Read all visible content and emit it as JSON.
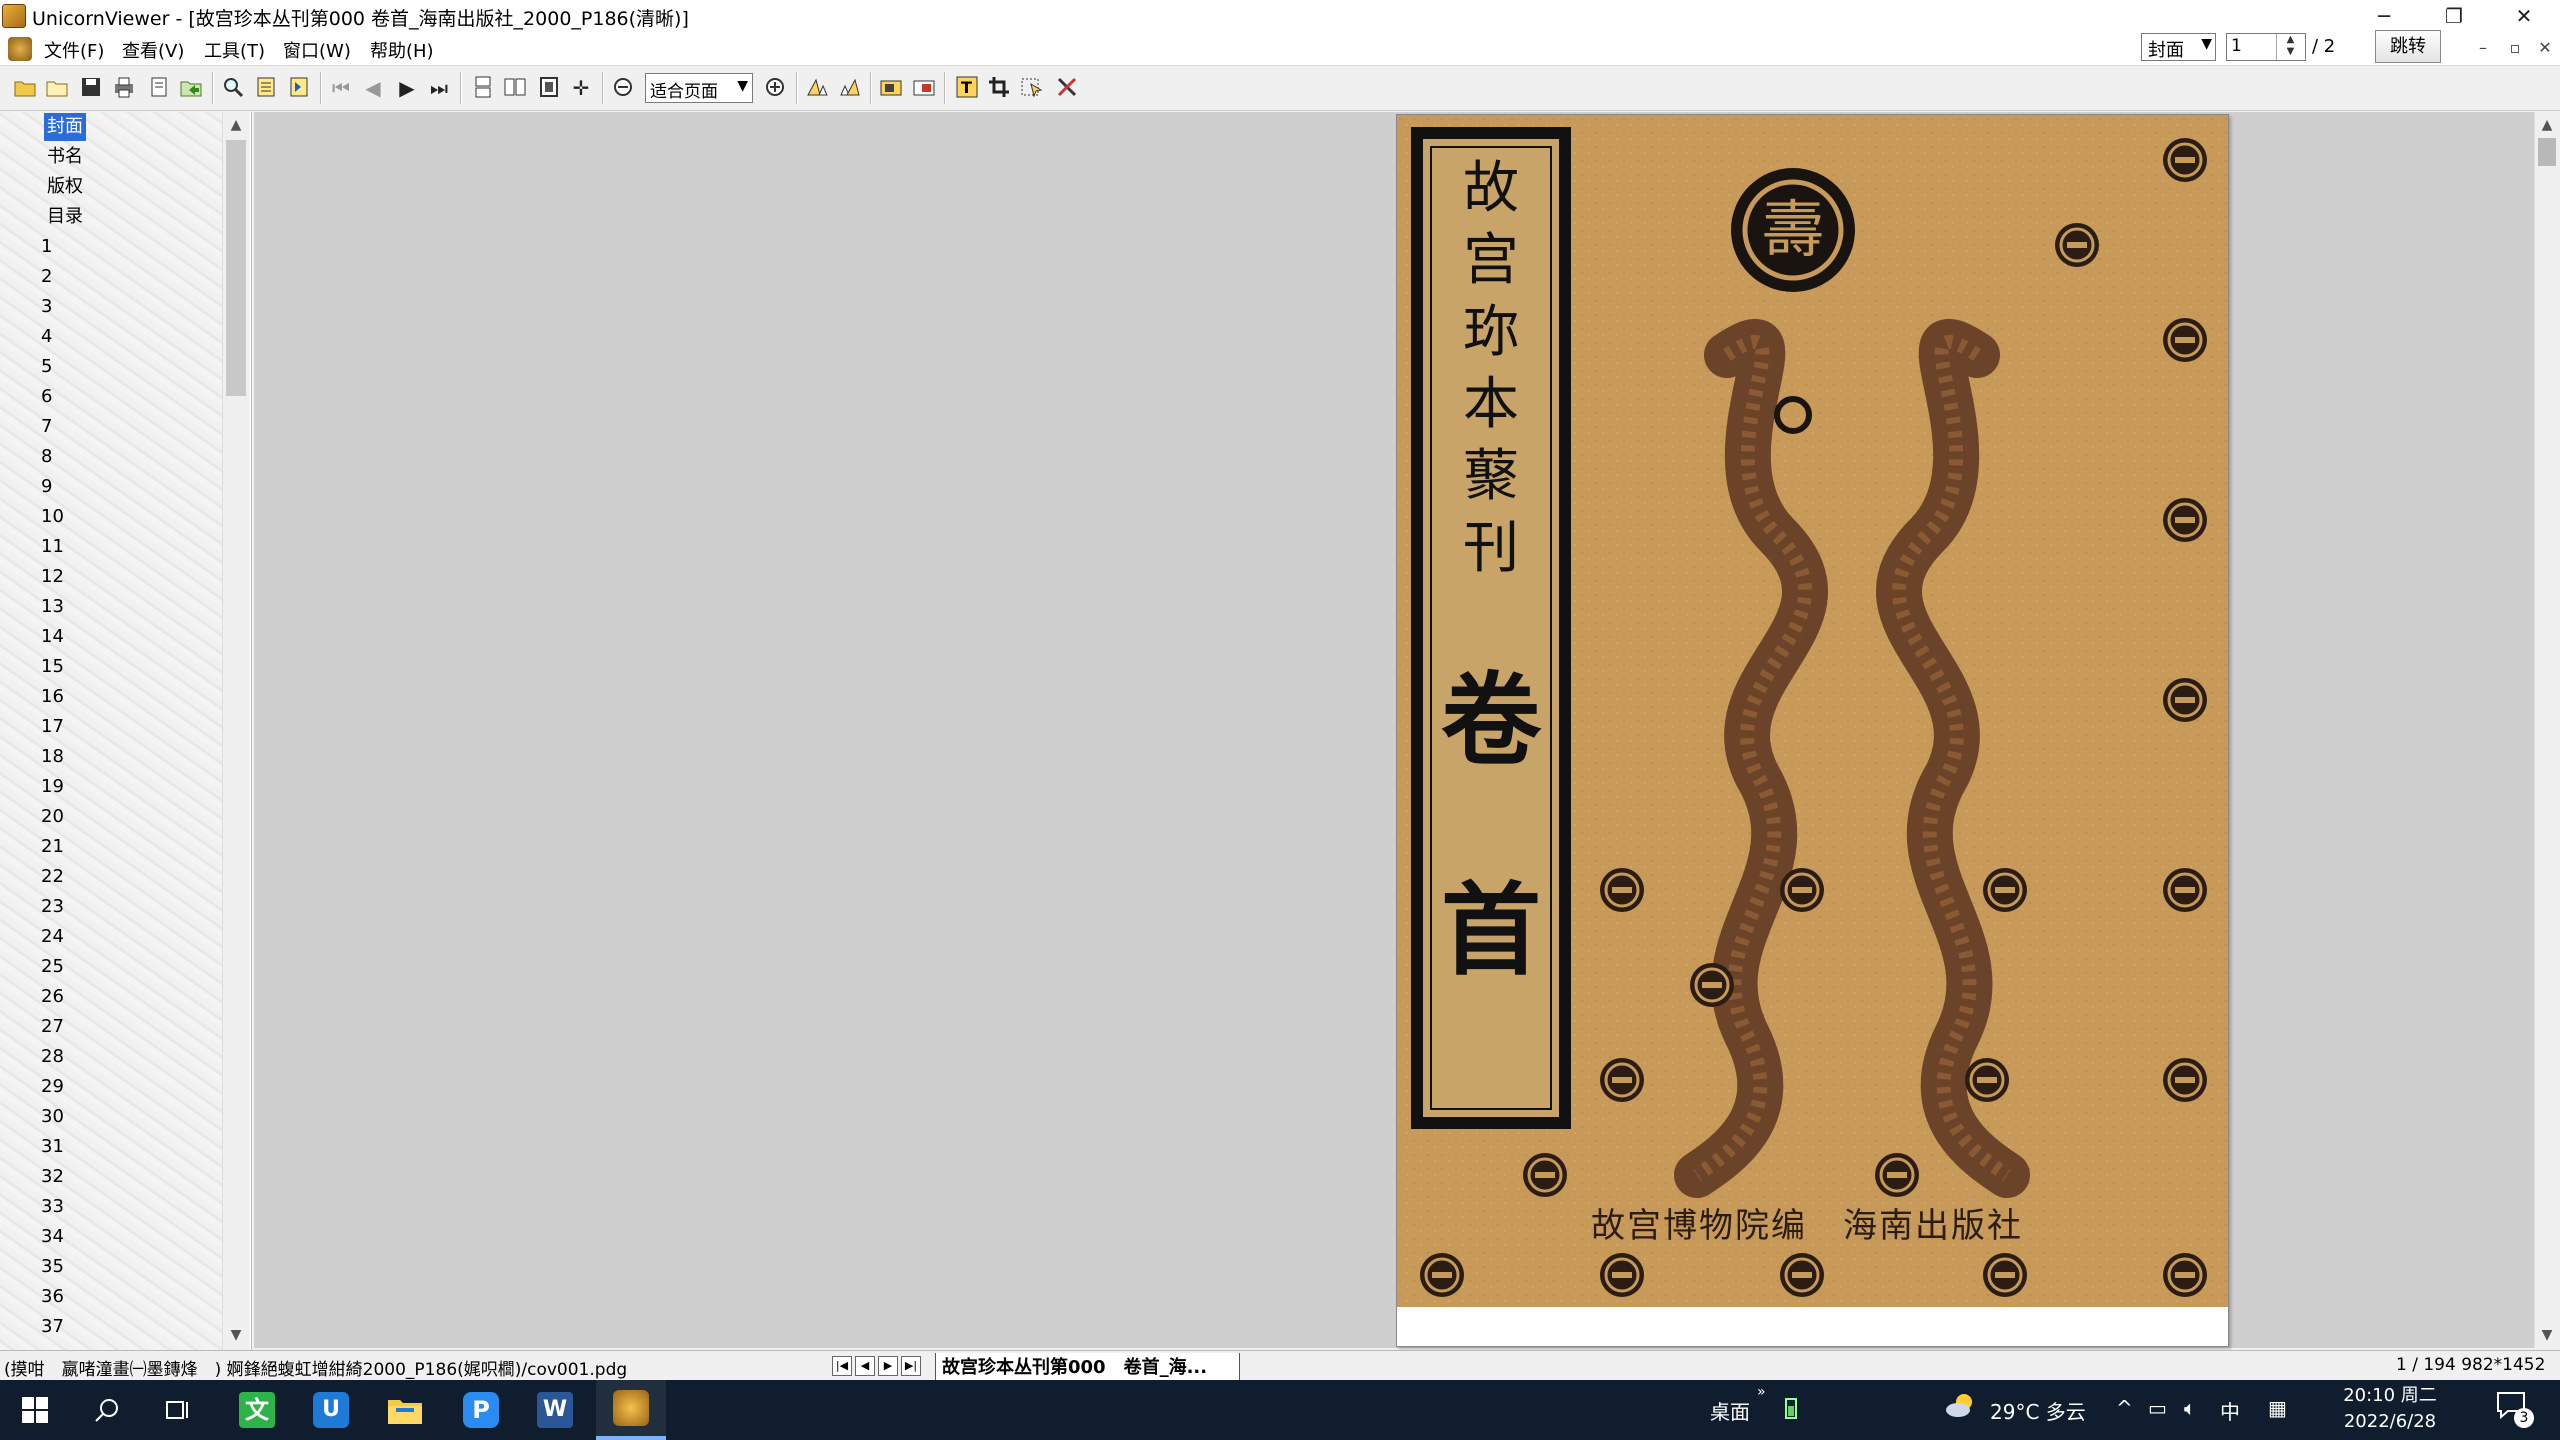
{
  "window": {
    "title": "UnicornViewer - [故宫珍本丛刊第000  卷首_海南出版社_2000_P186(清晰)]",
    "minimize": "─",
    "restore": "❐",
    "close": "✕"
  },
  "menu": {
    "items": [
      "文件(F)",
      "查看(V)",
      "工具(T)",
      "窗口(W)",
      "帮助(H)"
    ],
    "page_type_selected": "封面",
    "page_input": "1",
    "page_total": "/ 2",
    "goto_label": "跳转",
    "mdi": [
      "–",
      "▫",
      "✕"
    ]
  },
  "toolbar": {
    "zoom_selected": "适合页面"
  },
  "tree": {
    "items": [
      "封面",
      "书名",
      "版权",
      "目录",
      "1",
      "2",
      "3",
      "4",
      "5",
      "6",
      "7",
      "8",
      "9",
      "10",
      "11",
      "12",
      "13",
      "14",
      "15",
      "16",
      "17",
      "18",
      "19",
      "20",
      "21",
      "22",
      "23",
      "24",
      "25",
      "26",
      "27",
      "28",
      "29",
      "30",
      "31",
      "32",
      "33",
      "34",
      "35",
      "36",
      "37"
    ],
    "selected": "封面"
  },
  "cover": {
    "title_chars": [
      "故",
      "宫",
      "珎",
      "本",
      "藂",
      "刊"
    ],
    "volume_chars": [
      "卷",
      "首"
    ],
    "publisher_line": "故宫博物院编　海南出版社",
    "seal_char": "壽",
    "colors": {
      "background": "#c79a5a",
      "dragon": "#5a3420",
      "ink": "#111111"
    }
  },
  "status": {
    "left": "(摸咁　嬴啫潼畫㈠墨鏄烽　) 婀鋒絕蝮虹增紺綺2000_P186(娓呮櫚)/cov001.pdg",
    "doc_tab": "故宫珍本丛刊第000　卷首_海...",
    "right": "1 / 194 982*1452"
  },
  "taskbar": {
    "desktop_label": "桌面",
    "weather": "29°C  多云",
    "ime": "中",
    "time": "20:10 周二",
    "date": "2022/6/28",
    "notification_count": "3"
  }
}
